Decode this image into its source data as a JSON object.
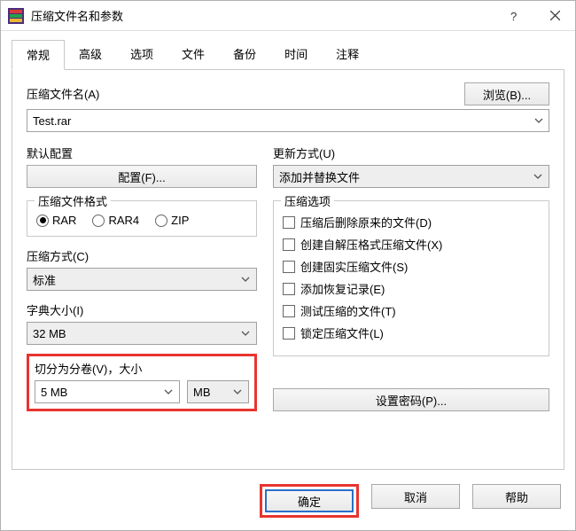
{
  "titlebar": {
    "title": "压缩文件名和参数"
  },
  "tabs": [
    {
      "label": "常规"
    },
    {
      "label": "高级"
    },
    {
      "label": "选项"
    },
    {
      "label": "文件"
    },
    {
      "label": "备份"
    },
    {
      "label": "时间"
    },
    {
      "label": "注释"
    }
  ],
  "filename": {
    "label": "压缩文件名(A)",
    "value": "Test.rar",
    "browse": "浏览(B)..."
  },
  "default_profile": {
    "label": "默认配置",
    "button": "配置(F)..."
  },
  "update_mode": {
    "label": "更新方式(U)",
    "value": "添加并替换文件"
  },
  "archive_format": {
    "legend": "压缩文件格式",
    "options": [
      "RAR",
      "RAR4",
      "ZIP"
    ],
    "selected": "RAR"
  },
  "compression_method": {
    "label": "压缩方式(C)",
    "value": "标准"
  },
  "dictionary_size": {
    "label": "字典大小(I)",
    "value": "32 MB"
  },
  "split": {
    "label": "切分为分卷(V)，大小",
    "value": "5 MB",
    "unit": "MB"
  },
  "archive_options": {
    "legend": "压缩选项",
    "items": [
      "压缩后删除原来的文件(D)",
      "创建自解压格式压缩文件(X)",
      "创建固实压缩文件(S)",
      "添加恢复记录(E)",
      "测试压缩的文件(T)",
      "锁定压缩文件(L)"
    ]
  },
  "set_password": "设置密码(P)...",
  "buttons": {
    "ok": "确定",
    "cancel": "取消",
    "help": "帮助"
  }
}
